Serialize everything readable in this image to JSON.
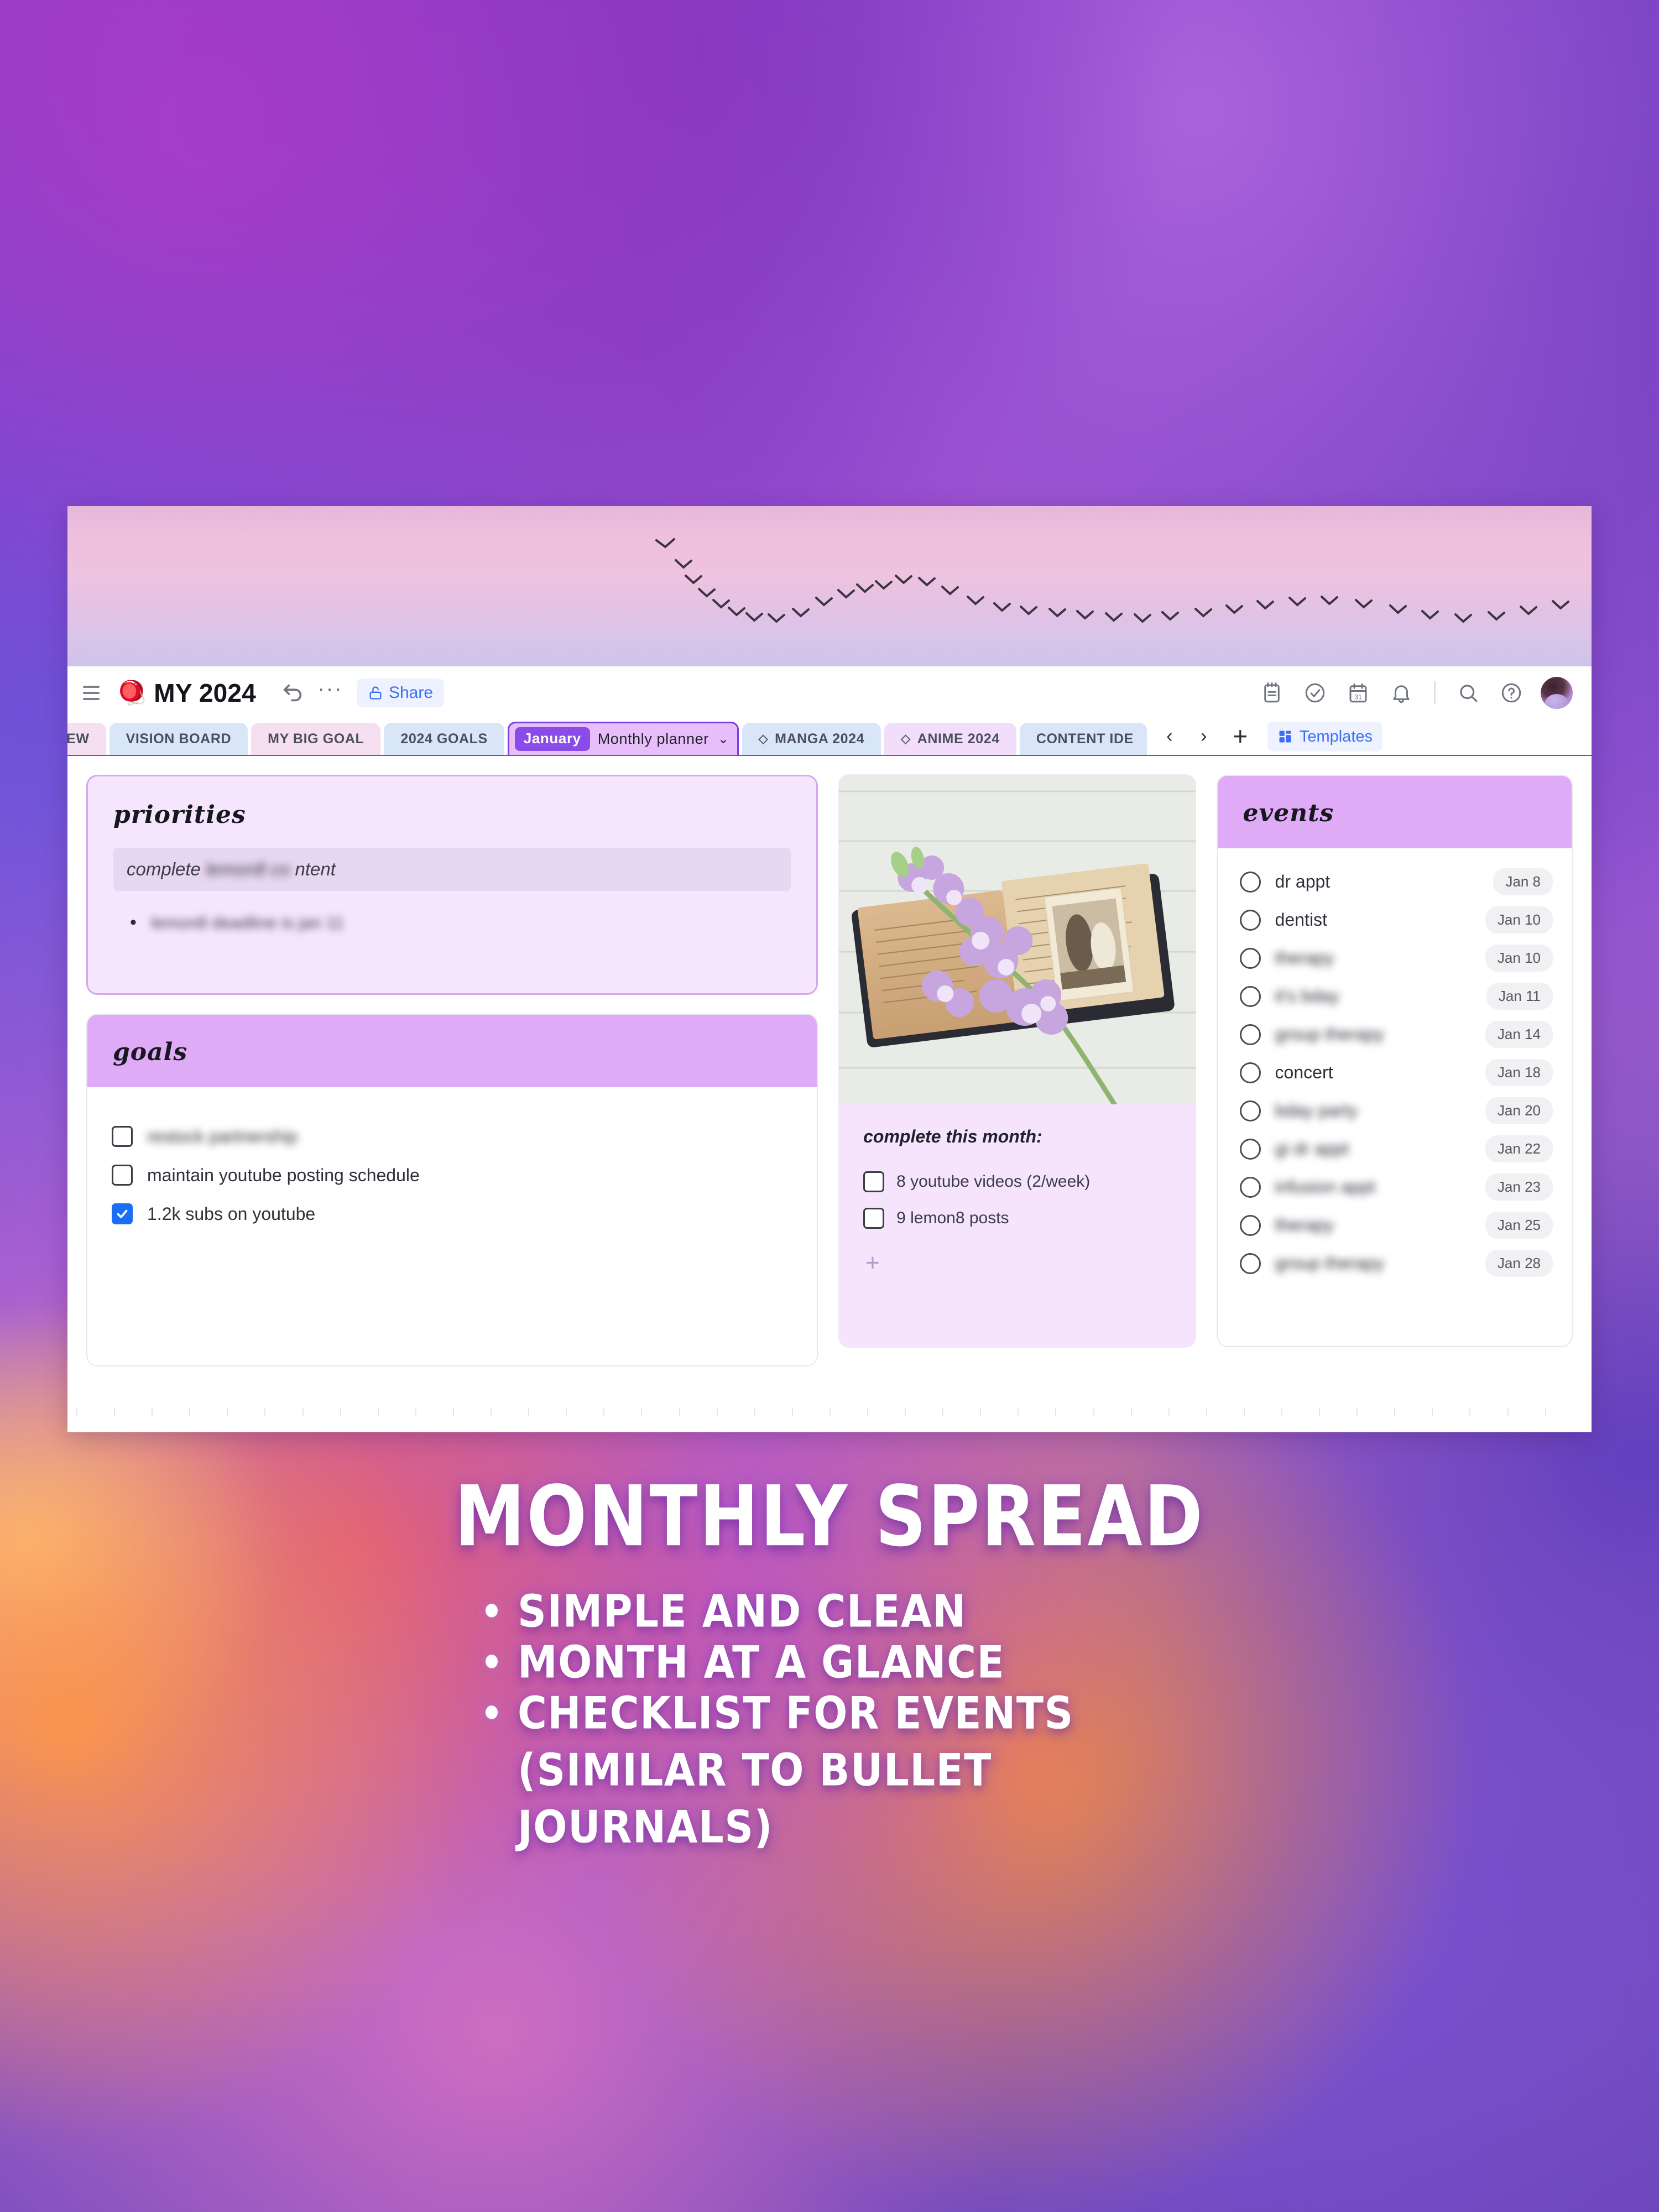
{
  "header": {
    "menu_icon": "hamburger-menu-icon",
    "page_emoji": "🪀",
    "title": "MY 2024",
    "undo_icon": "undo-arrow-icon",
    "more_icon": "more-options-icon",
    "share_label": "Share",
    "share_icon": "unlock-icon",
    "tools": [
      {
        "name": "notepad-icon"
      },
      {
        "name": "tasks-check-icon"
      },
      {
        "name": "calendar-icon"
      },
      {
        "name": "bell-notification-icon"
      },
      {
        "name": "search-icon"
      },
      {
        "name": "help-question-icon"
      }
    ],
    "avatar_name": "user-avatar"
  },
  "tabs": {
    "items": [
      {
        "label": "EVIEW",
        "style": "pink",
        "clipped": true,
        "active": false
      },
      {
        "label": "VISION BOARD",
        "style": "blue",
        "active": false
      },
      {
        "label": "MY BIG GOAL",
        "style": "pink",
        "active": false
      },
      {
        "label": "2024 GOALS",
        "style": "blue",
        "active": false
      },
      {
        "label": "MANGA 2024",
        "style": "blue",
        "icon": "diamond-icon",
        "active": false
      },
      {
        "label": "ANIME 2024",
        "style": "lilac",
        "icon": "diamond-icon",
        "active": false
      },
      {
        "label": "CONTENT IDE",
        "style": "blue",
        "active": false
      }
    ],
    "active_tab": {
      "pill": "January",
      "label": "Monthly planner",
      "chevron": "chevron-down-icon"
    },
    "prev_icon": "chevron-left-icon",
    "next_icon": "chevron-right-icon",
    "add_icon": "plus-icon",
    "templates_label": "Templates",
    "templates_icon": "grid-templates-icon"
  },
  "priorities": {
    "heading": "priorities",
    "input_value": "complete lemon8 content",
    "input_visible_prefix": "complete",
    "input_visible_suffix": "ntent",
    "bullet": "lemon8 deadline is jan 11"
  },
  "goals": {
    "heading": "goals",
    "items": [
      {
        "label": "restock partnership",
        "checked": false,
        "redacted": true
      },
      {
        "label": "maintain youtube posting schedule",
        "checked": false,
        "redacted": false
      },
      {
        "label": "1.2k subs on youtube",
        "checked": true,
        "redacted": false
      }
    ]
  },
  "photo_card": {
    "image_name": "vintage-journal-with-lilac-flowers-photo",
    "caption": "complete this month:",
    "items": [
      {
        "label": "8 youtube videos (2/week)",
        "checked": false
      },
      {
        "label": "9 lemon8 posts",
        "checked": false
      }
    ],
    "add_icon": "plus-icon"
  },
  "events": {
    "heading": "events",
    "items": [
      {
        "name": "dr appt",
        "date": "Jan 8",
        "redacted": false
      },
      {
        "name": "dentist",
        "date": "Jan 10",
        "redacted": false
      },
      {
        "name": "therapy",
        "date": "Jan 10",
        "redacted": true
      },
      {
        "name": "it's bday",
        "date": "Jan 11",
        "redacted": true
      },
      {
        "name": "group therapy",
        "date": "Jan 14",
        "redacted": true
      },
      {
        "name": "concert",
        "date": "Jan 18",
        "redacted": false
      },
      {
        "name": "bday party",
        "date": "Jan 20",
        "redacted": true
      },
      {
        "name": "gi dr appt",
        "date": "Jan 22",
        "redacted": true
      },
      {
        "name": "infusion appt",
        "date": "Jan 23",
        "redacted": true
      },
      {
        "name": "therapy",
        "date": "Jan 25",
        "redacted": true
      },
      {
        "name": "group therapy",
        "date": "Jan 28",
        "redacted": true
      }
    ]
  },
  "overlay": {
    "title": "MONTHLY SPREAD",
    "bullets": [
      "SIMPLE AND CLEAN",
      "MONTH AT A GLANCE",
      "CHECKLIST FOR EVENTS (SIMILAR TO BULLET JOURNALS)"
    ]
  },
  "colors": {
    "accent_purple": "#7c3fe4",
    "tab_active_bg": "#e7bdfa",
    "card_header_lilac": "#dfabf7",
    "priorities_bg": "#f6e6fd",
    "link_blue": "#3b6ef5",
    "checkbox_checked": "#1a6ef5"
  }
}
